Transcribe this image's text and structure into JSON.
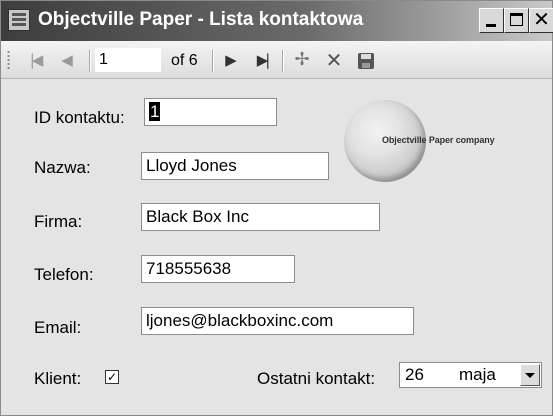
{
  "window": {
    "title": "Objectville Paper - Lista kontaktowa"
  },
  "toolbar": {
    "first_icon": "move-first-icon",
    "prev_icon": "move-previous-icon",
    "position_value": "1",
    "count_label": "of 6",
    "next_icon": "move-next-icon",
    "last_icon": "move-last-icon",
    "add_icon": "add-new-icon",
    "delete_icon": "delete-icon",
    "save_icon": "save-icon",
    "glyphs": {
      "first": "|◀",
      "prev": "◀",
      "next": "▶",
      "last": "▶|",
      "add": "✢",
      "delete": "✕"
    }
  },
  "form": {
    "id_label": "ID kontaktu:",
    "id_value": "1",
    "name_label": "Nazwa:",
    "name_value": "Lloyd Jones",
    "company_label": "Firma:",
    "company_value": "Black Box Inc",
    "phone_label": "Telefon:",
    "phone_value": "718555638",
    "email_label": "Email:",
    "email_value": "ljones@blackboxinc.com",
    "client_label": "Klient:",
    "client_checked": true,
    "client_mark": "✓",
    "last_contact_label": "Ostatni kontakt:",
    "last_contact_day": "26",
    "last_contact_month": "maja"
  },
  "logo": {
    "text": "Objectville Paper company"
  },
  "caption_buttons": {
    "close_glyph": "✕"
  }
}
